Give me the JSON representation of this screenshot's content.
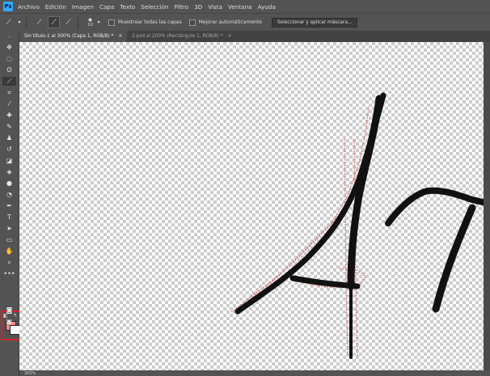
{
  "menu": {
    "items": [
      "Archivo",
      "Edición",
      "Imagen",
      "Capa",
      "Texto",
      "Selección",
      "Filtro",
      "3D",
      "Vista",
      "Ventana",
      "Ayuda"
    ]
  },
  "options": {
    "brush_size": "10",
    "sample_all_layers": "Muestrear todas las capas",
    "auto_enhance": "Mejorar automáticamente",
    "select_mask": "Seleccionar y aplicar máscara..."
  },
  "tabs": [
    {
      "label": "Sin título-1 al 300% (Capa 1, RGB/8) *",
      "active": true
    },
    {
      "label": "2.psd al 200% (Rectángulo 1, RGB/8) *",
      "active": false
    }
  ],
  "status": {
    "zoom": "300%"
  },
  "colors": {
    "foreground": "#f08b8b",
    "background": "#ffffff",
    "highlight": "#d81f2e"
  },
  "tools": [
    "move-icon",
    "marquee-icon",
    "lasso-icon",
    "quick-selection-icon",
    "crop-icon",
    "eyedropper-icon",
    "healing-icon",
    "brush-icon",
    "stamp-icon",
    "history-brush-icon",
    "eraser-icon",
    "paint-bucket-icon",
    "blur-icon",
    "dodge-icon",
    "pen-icon",
    "type-icon",
    "path-select-icon",
    "rectangle-icon",
    "hand-icon",
    "zoom-icon",
    "more-icon"
  ]
}
